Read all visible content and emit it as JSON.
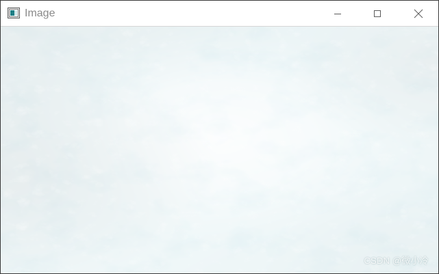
{
  "window": {
    "title": "Image",
    "icon": "image-window-icon",
    "controls": {
      "minimize_icon": "minimize-icon",
      "maximize_icon": "maximize-icon",
      "close_icon": "close-icon"
    }
  },
  "image": {
    "description_icon": "ocean-water-image",
    "colors": {
      "deep": "#0f5d6b",
      "mid": "#3f9fae",
      "light": "#9fd6dd",
      "foam": "#eef6f8"
    }
  },
  "watermark": {
    "text": "CSDN @微小冷"
  }
}
